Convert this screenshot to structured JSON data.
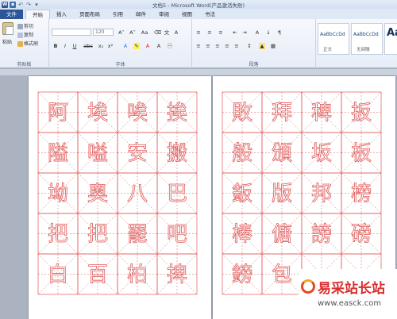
{
  "window": {
    "title": "文档5 - Microsoft Word(产品激活失败)"
  },
  "qat": {
    "word_logo": "W"
  },
  "tabs": [
    "文件",
    "开始",
    "插入",
    "页面布局",
    "引用",
    "邮件",
    "审阅",
    "视图",
    "书法"
  ],
  "clipboard": {
    "paste": "粘贴",
    "cut": "剪切",
    "copy": "复制",
    "format_painter": "格式刷",
    "label": "剪贴板"
  },
  "font": {
    "size": "120",
    "grow": "A˄",
    "shrink": "A˅",
    "case": "Aa",
    "label": "字体",
    "bold": "B",
    "italic": "I",
    "underline": "U",
    "strike": "abc",
    "sub": "x₂",
    "sup": "x²"
  },
  "paragraph": {
    "label": "段落"
  },
  "styles": {
    "items": [
      {
        "preview": "AaBbCcDd",
        "name": "正文"
      },
      {
        "preview": "AaBbCcDd",
        "name": "无间隔"
      },
      {
        "preview": "Aa",
        "name": ""
      }
    ]
  },
  "pages": [
    {
      "rows": [
        [
          "阿",
          "埃",
          "唉",
          "挨"
        ],
        [
          "隘",
          "嗌",
          "安",
          "搬"
        ],
        [
          "坳",
          "奥",
          "八",
          "巴"
        ],
        [
          "把",
          "把",
          "罷",
          "吧"
        ],
        [
          "白",
          "百",
          "柏",
          "捭"
        ]
      ]
    },
    {
      "rows": [
        [
          "敗",
          "拜",
          "稗",
          "扳"
        ],
        [
          "般",
          "頒",
          "坂",
          "板"
        ],
        [
          "鈑",
          "版",
          "邦",
          "榜"
        ],
        [
          "棒",
          "傏",
          "謗",
          "磅"
        ],
        [
          "鎊",
          "包",
          "",
          ""
        ]
      ]
    }
  ],
  "watermark": {
    "title": "易采站长站",
    "url": "www.easck.com"
  },
  "colors": {
    "file_tab": "#2b579a",
    "glyph_outline": "#e05a5a",
    "grid_line": "#e05a5a"
  }
}
